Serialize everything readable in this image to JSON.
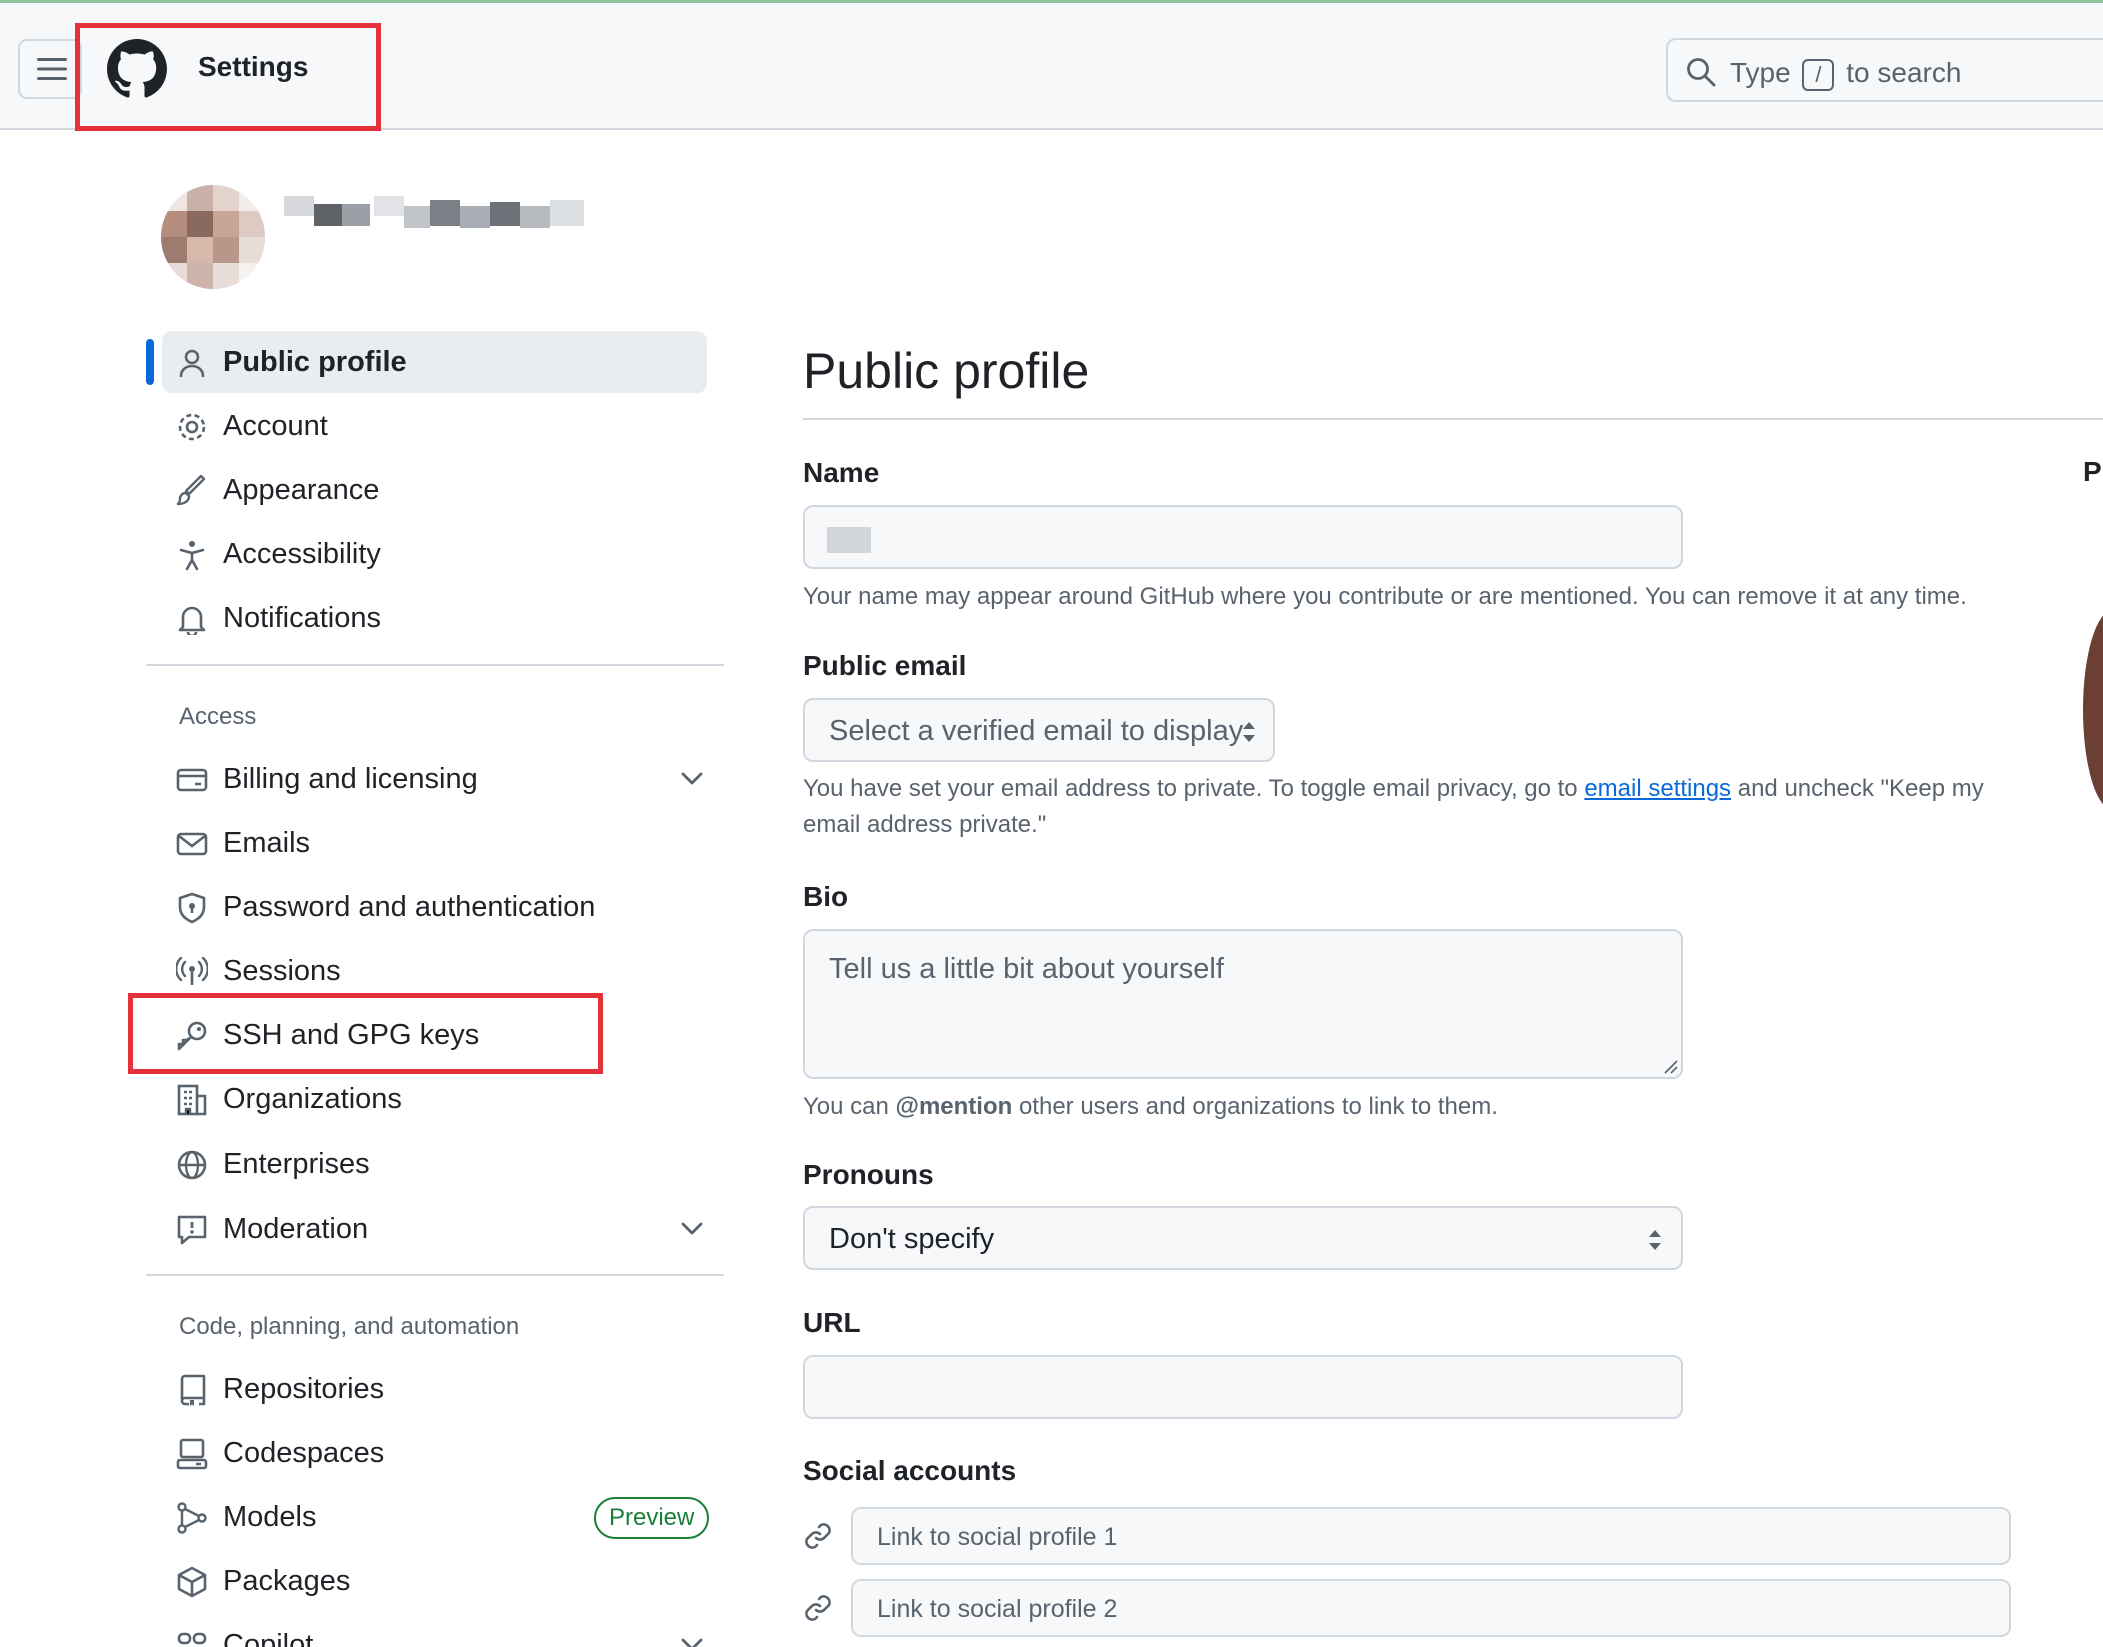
{
  "header": {
    "title": "Settings",
    "search_prefix": "Type",
    "search_key": "/",
    "search_suffix": "to search"
  },
  "sidebar": {
    "primary_items": [
      {
        "label": "Public profile",
        "icon": "person-icon",
        "active": true
      },
      {
        "label": "Account",
        "icon": "gear-icon"
      },
      {
        "label": "Appearance",
        "icon": "paintbrush-icon"
      },
      {
        "label": "Accessibility",
        "icon": "accessibility-icon"
      },
      {
        "label": "Notifications",
        "icon": "bell-icon"
      }
    ],
    "access_heading": "Access",
    "access_items": [
      {
        "label": "Billing and licensing",
        "icon": "credit-card-icon",
        "expandable": true
      },
      {
        "label": "Emails",
        "icon": "mail-icon"
      },
      {
        "label": "Password and authentication",
        "icon": "shield-lock-icon"
      },
      {
        "label": "Sessions",
        "icon": "broadcast-icon"
      },
      {
        "label": "SSH and GPG keys",
        "icon": "key-icon"
      },
      {
        "label": "Organizations",
        "icon": "organization-icon"
      },
      {
        "label": "Enterprises",
        "icon": "globe-icon"
      },
      {
        "label": "Moderation",
        "icon": "report-icon",
        "expandable": true
      }
    ],
    "code_heading": "Code, planning, and automation",
    "code_items": [
      {
        "label": "Repositories",
        "icon": "repo-icon"
      },
      {
        "label": "Codespaces",
        "icon": "codespaces-icon"
      },
      {
        "label": "Models",
        "icon": "models-icon",
        "badge": "Preview"
      },
      {
        "label": "Packages",
        "icon": "package-icon"
      },
      {
        "label": "Copilot",
        "icon": "copilot-icon",
        "expandable": true
      }
    ]
  },
  "main": {
    "title": "Public profile",
    "name_label": "Name",
    "name_help": "Your name may appear around GitHub where you contribute or are mentioned. You can remove it at any time.",
    "email_label": "Public email",
    "email_select": "Select a verified email to display",
    "email_help_before": "You have set your email address to private. To toggle email privacy, go to",
    "email_help_link": "email settings",
    "email_help_after": "and uncheck \"Keep my email address private.\"",
    "bio_label": "Bio",
    "bio_placeholder": "Tell us a little bit about yourself",
    "bio_help_before": "You can",
    "bio_help_mention": "@mention",
    "bio_help_after": "other users and organizations to link to them.",
    "pronouns_label": "Pronouns",
    "pronouns_value": "Don't specify",
    "url_label": "URL",
    "social_label": "Social accounts",
    "social_placeholders": [
      "Link to social profile 1",
      "Link to social profile 2"
    ],
    "right_cut_label": "Pr"
  }
}
